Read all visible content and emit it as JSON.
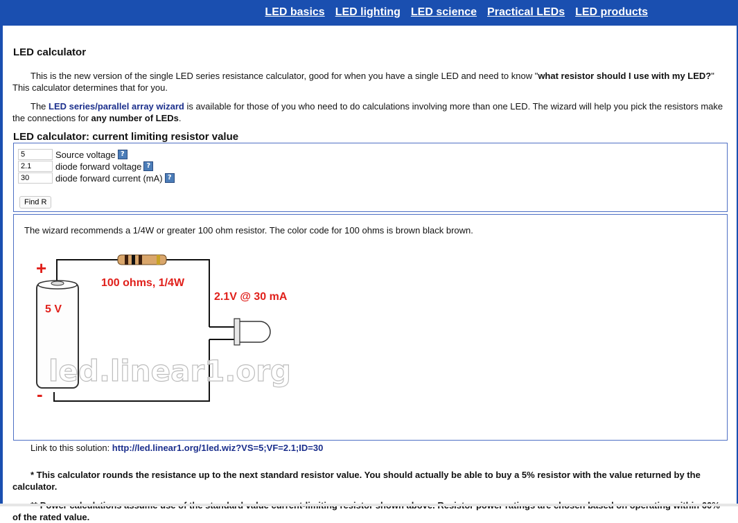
{
  "nav": {
    "items": [
      "LED basics",
      "LED lighting",
      "LED science",
      "Practical LEDs",
      "LED products"
    ]
  },
  "page": {
    "title": "LED calculator",
    "intro_pre": "This is the new version of the single LED series resistance calculator, good for when you have a single LED and need to know \"",
    "intro_bold": "what resistor should I use with my LED?",
    "intro_post": "\" This calculator determines that for you.",
    "wizard_pre": "The ",
    "wizard_link": "LED series/parallel array wizard",
    "wizard_mid": " is available for those of you who need to do calculations involving more than one LED. The wizard will help you pick the resistors make the connections for ",
    "wizard_bold": "any number of LEDs",
    "wizard_post": "."
  },
  "calculator": {
    "section_title": "LED calculator: current limiting resistor value",
    "fields": [
      {
        "value": "5",
        "label": "Source voltage"
      },
      {
        "value": "2.1",
        "label": "diode forward voltage"
      },
      {
        "value": "30",
        "label": "diode forward current (mA)"
      }
    ],
    "help_glyph": "?",
    "button_label": "Find R"
  },
  "result": {
    "text": "The wizard recommends a 1/4W or greater 100 ohm resistor. The color code for 100 ohms is brown black brown.",
    "diagram": {
      "plus": "+",
      "minus": "-",
      "battery_label": "5 V",
      "resistor_label": "100 ohms, 1/4W",
      "led_label": "2.1V @ 30 mA",
      "watermark": "led.linear1.org",
      "resistor_bands": [
        "#3b1e0e",
        "#111111",
        "#3b1e0e",
        "#c9a227"
      ]
    }
  },
  "link_line": {
    "prefix": "Link to this solution: ",
    "url": "http://led.linear1.org/1led.wiz?VS=5;VF=2.1;ID=30"
  },
  "notes": [
    "* This calculator rounds the resistance up to the next standard resistor value. You should actually be able to buy a 5% resistor with the value returned by the calculator.",
    "** Power calculations assume use of the standard value current-limiting resistor shown above. Resistor power ratings are chosen based on operating within 60% of the rated value."
  ],
  "colors": {
    "brand_blue": "#1a4fb0",
    "link_blue": "#1b2f8c",
    "diagram_red": "#e0201b"
  }
}
